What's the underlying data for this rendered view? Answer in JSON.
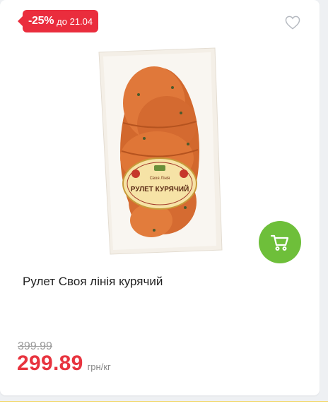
{
  "promo": {
    "discount": "-25%",
    "valid_until": "до 21.04",
    "color": "#ea2d3d"
  },
  "wishlist": {
    "icon": "heart-outline-icon"
  },
  "product": {
    "image_icon": "product-image",
    "title": "Рулет Своя лінія курячий",
    "label_brand": "Своя Лінія",
    "label_text": "РУЛЕТ КУРЯЧИЙ"
  },
  "cart": {
    "icon": "cart-icon",
    "color": "#6ebf3a"
  },
  "pricing": {
    "old_price": "399.99",
    "price": "299.89",
    "unit": "грн/кг",
    "price_color": "#e8343f"
  }
}
